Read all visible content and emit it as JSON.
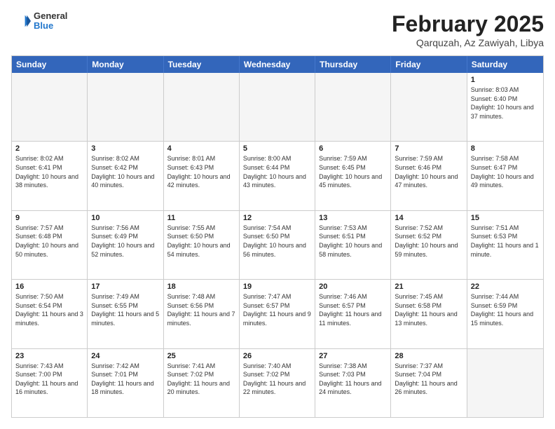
{
  "header": {
    "logo": {
      "general": "General",
      "blue": "Blue"
    },
    "month": "February 2025",
    "location": "Qarquzah, Az Zawiyah, Libya"
  },
  "weekdays": [
    "Sunday",
    "Monday",
    "Tuesday",
    "Wednesday",
    "Thursday",
    "Friday",
    "Saturday"
  ],
  "rows": [
    [
      {
        "day": "",
        "info": ""
      },
      {
        "day": "",
        "info": ""
      },
      {
        "day": "",
        "info": ""
      },
      {
        "day": "",
        "info": ""
      },
      {
        "day": "",
        "info": ""
      },
      {
        "day": "",
        "info": ""
      },
      {
        "day": "1",
        "info": "Sunrise: 8:03 AM\nSunset: 6:40 PM\nDaylight: 10 hours and 37 minutes."
      }
    ],
    [
      {
        "day": "2",
        "info": "Sunrise: 8:02 AM\nSunset: 6:41 PM\nDaylight: 10 hours and 38 minutes."
      },
      {
        "day": "3",
        "info": "Sunrise: 8:02 AM\nSunset: 6:42 PM\nDaylight: 10 hours and 40 minutes."
      },
      {
        "day": "4",
        "info": "Sunrise: 8:01 AM\nSunset: 6:43 PM\nDaylight: 10 hours and 42 minutes."
      },
      {
        "day": "5",
        "info": "Sunrise: 8:00 AM\nSunset: 6:44 PM\nDaylight: 10 hours and 43 minutes."
      },
      {
        "day": "6",
        "info": "Sunrise: 7:59 AM\nSunset: 6:45 PM\nDaylight: 10 hours and 45 minutes."
      },
      {
        "day": "7",
        "info": "Sunrise: 7:59 AM\nSunset: 6:46 PM\nDaylight: 10 hours and 47 minutes."
      },
      {
        "day": "8",
        "info": "Sunrise: 7:58 AM\nSunset: 6:47 PM\nDaylight: 10 hours and 49 minutes."
      }
    ],
    [
      {
        "day": "9",
        "info": "Sunrise: 7:57 AM\nSunset: 6:48 PM\nDaylight: 10 hours and 50 minutes."
      },
      {
        "day": "10",
        "info": "Sunrise: 7:56 AM\nSunset: 6:49 PM\nDaylight: 10 hours and 52 minutes."
      },
      {
        "day": "11",
        "info": "Sunrise: 7:55 AM\nSunset: 6:50 PM\nDaylight: 10 hours and 54 minutes."
      },
      {
        "day": "12",
        "info": "Sunrise: 7:54 AM\nSunset: 6:50 PM\nDaylight: 10 hours and 56 minutes."
      },
      {
        "day": "13",
        "info": "Sunrise: 7:53 AM\nSunset: 6:51 PM\nDaylight: 10 hours and 58 minutes."
      },
      {
        "day": "14",
        "info": "Sunrise: 7:52 AM\nSunset: 6:52 PM\nDaylight: 10 hours and 59 minutes."
      },
      {
        "day": "15",
        "info": "Sunrise: 7:51 AM\nSunset: 6:53 PM\nDaylight: 11 hours and 1 minute."
      }
    ],
    [
      {
        "day": "16",
        "info": "Sunrise: 7:50 AM\nSunset: 6:54 PM\nDaylight: 11 hours and 3 minutes."
      },
      {
        "day": "17",
        "info": "Sunrise: 7:49 AM\nSunset: 6:55 PM\nDaylight: 11 hours and 5 minutes."
      },
      {
        "day": "18",
        "info": "Sunrise: 7:48 AM\nSunset: 6:56 PM\nDaylight: 11 hours and 7 minutes."
      },
      {
        "day": "19",
        "info": "Sunrise: 7:47 AM\nSunset: 6:57 PM\nDaylight: 11 hours and 9 minutes."
      },
      {
        "day": "20",
        "info": "Sunrise: 7:46 AM\nSunset: 6:57 PM\nDaylight: 11 hours and 11 minutes."
      },
      {
        "day": "21",
        "info": "Sunrise: 7:45 AM\nSunset: 6:58 PM\nDaylight: 11 hours and 13 minutes."
      },
      {
        "day": "22",
        "info": "Sunrise: 7:44 AM\nSunset: 6:59 PM\nDaylight: 11 hours and 15 minutes."
      }
    ],
    [
      {
        "day": "23",
        "info": "Sunrise: 7:43 AM\nSunset: 7:00 PM\nDaylight: 11 hours and 16 minutes."
      },
      {
        "day": "24",
        "info": "Sunrise: 7:42 AM\nSunset: 7:01 PM\nDaylight: 11 hours and 18 minutes."
      },
      {
        "day": "25",
        "info": "Sunrise: 7:41 AM\nSunset: 7:02 PM\nDaylight: 11 hours and 20 minutes."
      },
      {
        "day": "26",
        "info": "Sunrise: 7:40 AM\nSunset: 7:02 PM\nDaylight: 11 hours and 22 minutes."
      },
      {
        "day": "27",
        "info": "Sunrise: 7:38 AM\nSunset: 7:03 PM\nDaylight: 11 hours and 24 minutes."
      },
      {
        "day": "28",
        "info": "Sunrise: 7:37 AM\nSunset: 7:04 PM\nDaylight: 11 hours and 26 minutes."
      },
      {
        "day": "",
        "info": ""
      }
    ]
  ]
}
